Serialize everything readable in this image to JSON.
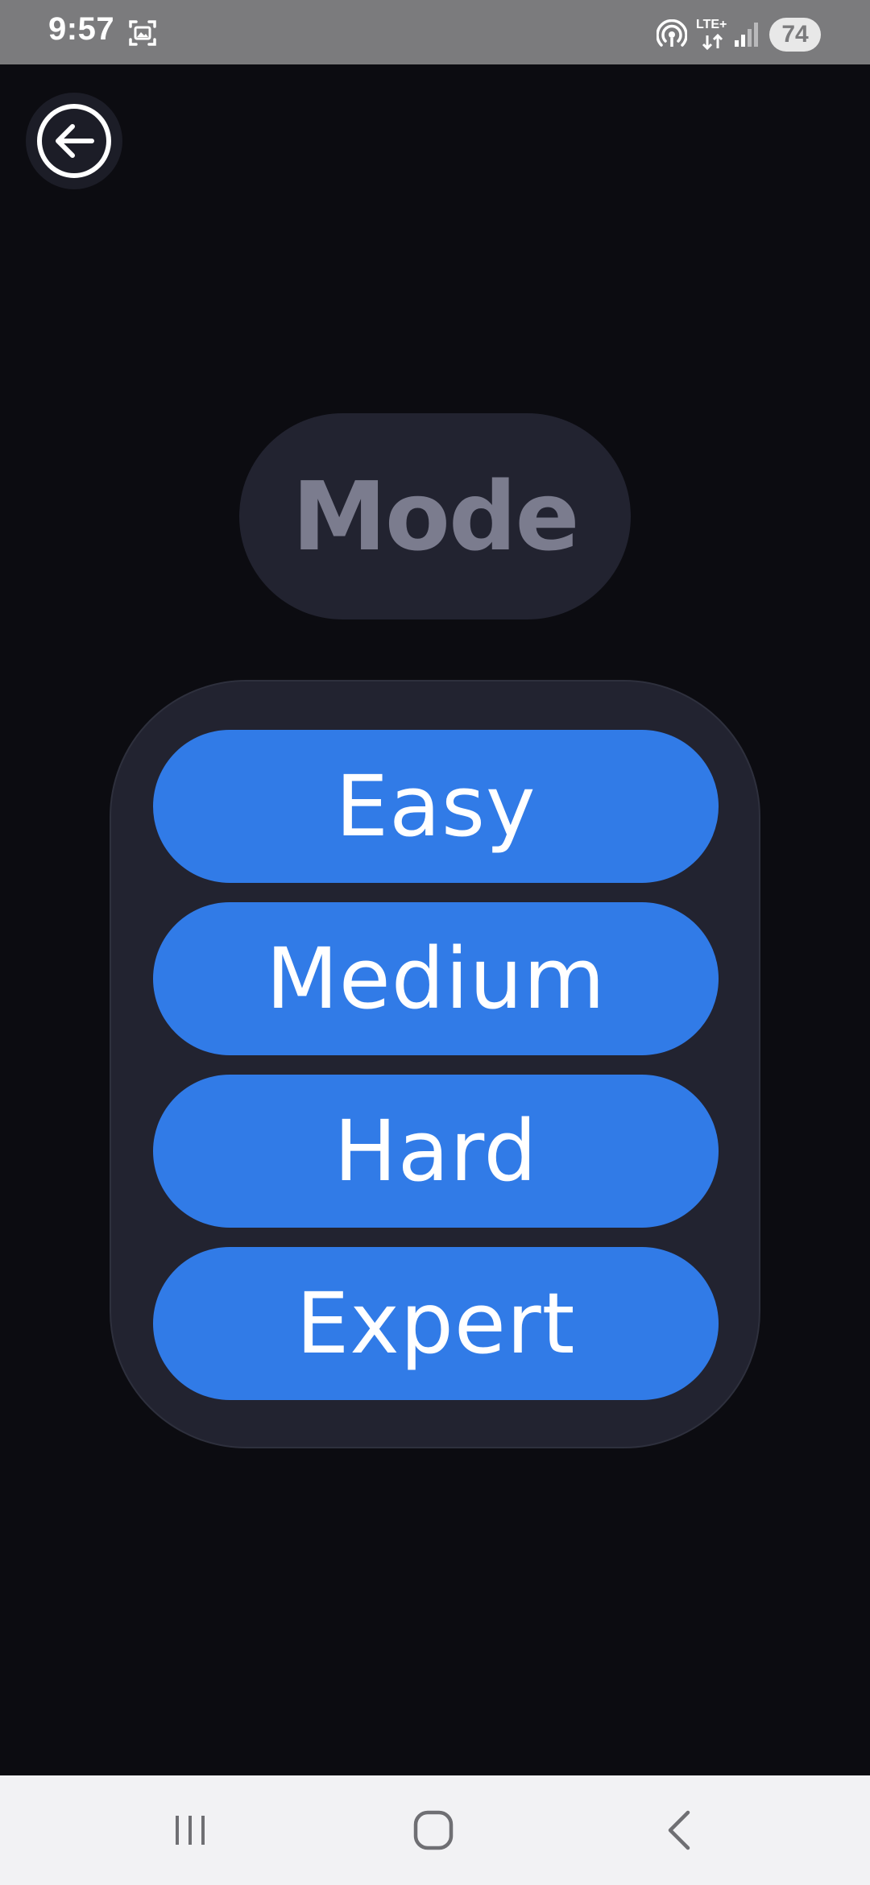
{
  "status_bar": {
    "time": "9:57",
    "network": "LTE+",
    "battery": "74",
    "icons": [
      "screenshot-icon",
      "hotspot-icon",
      "lte-icon",
      "signal-icon",
      "battery-icon"
    ]
  },
  "header": {
    "back_icon": "arrow-left-circle-icon"
  },
  "title": {
    "text": "Mode"
  },
  "modes": {
    "easy": "Easy",
    "medium": "Medium",
    "hard": "Hard",
    "expert": "Expert"
  },
  "nav_bar": {
    "icons": [
      "recents-icon",
      "home-icon",
      "back-icon"
    ]
  },
  "colors": {
    "background": "#0c0c11",
    "panel": "#222330",
    "accent": "#317be7",
    "title_text": "#7b7c8e",
    "status_bar": "#7b7b7d",
    "nav_bar": "#f2f2f4"
  }
}
